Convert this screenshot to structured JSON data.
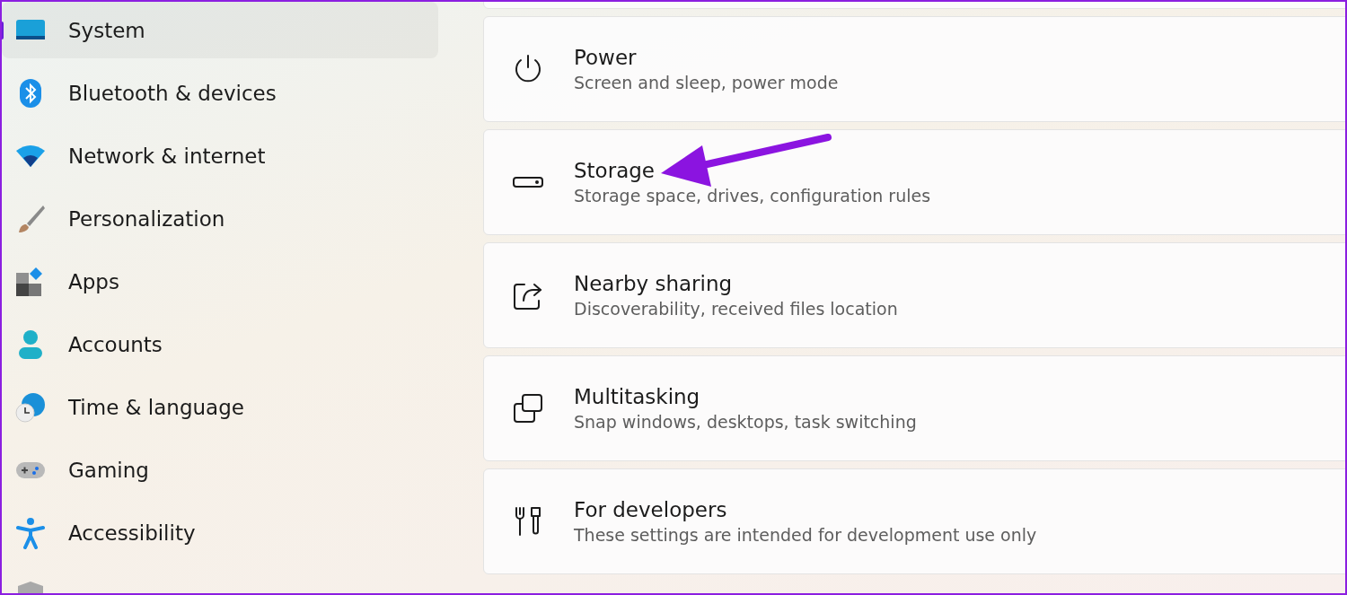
{
  "sidebar": {
    "items": [
      {
        "label": "System",
        "kind": "system",
        "selected": true
      },
      {
        "label": "Bluetooth & devices",
        "kind": "bluetooth",
        "selected": false
      },
      {
        "label": "Network & internet",
        "kind": "network",
        "selected": false
      },
      {
        "label": "Personalization",
        "kind": "personalization",
        "selected": false
      },
      {
        "label": "Apps",
        "kind": "apps",
        "selected": false
      },
      {
        "label": "Accounts",
        "kind": "accounts",
        "selected": false
      },
      {
        "label": "Time & language",
        "kind": "time",
        "selected": false
      },
      {
        "label": "Gaming",
        "kind": "gaming",
        "selected": false
      },
      {
        "label": "Accessibility",
        "kind": "accessibility",
        "selected": false
      },
      {
        "kind": "privacy",
        "selected": false
      }
    ]
  },
  "settings": [
    {
      "title": "Power",
      "description": "Screen and sleep, power mode",
      "kind": "power"
    },
    {
      "title": "Storage",
      "description": "Storage space, drives, configuration rules",
      "kind": "storage"
    },
    {
      "title": "Nearby sharing",
      "description": "Discoverability, received files location",
      "kind": "sharing"
    },
    {
      "title": "Multitasking",
      "description": "Snap windows, desktops, task switching",
      "kind": "multitasking"
    },
    {
      "title": "For developers",
      "description": "These settings are intended for development use only",
      "kind": "developers"
    }
  ]
}
